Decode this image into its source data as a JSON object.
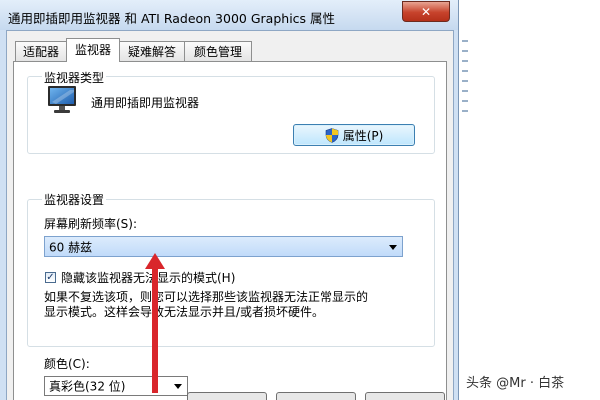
{
  "window": {
    "title": "通用即插即用监视器 和 ATI Radeon 3000 Graphics 属性",
    "close_glyph": "✕"
  },
  "tabs": [
    {
      "label": "适配器"
    },
    {
      "label": "监视器",
      "active": true
    },
    {
      "label": "疑难解答"
    },
    {
      "label": "颜色管理"
    }
  ],
  "monitor_type": {
    "group_label": "监视器类型",
    "monitor_name": "通用即插即用监视器",
    "properties_button": "属性(P)"
  },
  "monitor_settings": {
    "group_label": "监视器设置",
    "refresh_label": "屏幕刷新频率(S):",
    "refresh_value": "60 赫兹",
    "hide_modes_label": "隐藏该监视器无法显示的模式(H)",
    "hide_modes_checked": true,
    "description_line1": "如果不复选该项，则您可以选择那些该监视器无法正常显示的",
    "description_line2": "显示模式。这样会导致无法显示并且/或者损坏硬件。"
  },
  "color": {
    "label": "颜色(C):",
    "value": "真彩色(32 位)"
  },
  "watermark": "头条 @Mr · 白茶",
  "colors": {
    "annotation_arrow": "#d9262b",
    "accent": "#3c7fb1"
  },
  "icons": [
    "monitor-icon",
    "uac-shield-icon",
    "close-icon",
    "chevron-down-icon"
  ]
}
